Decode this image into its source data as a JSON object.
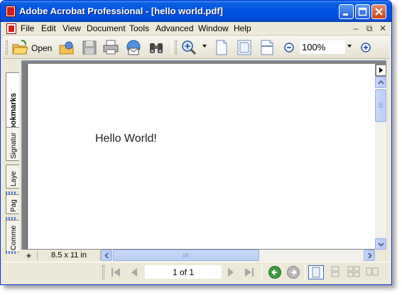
{
  "window": {
    "title": "Adobe Acrobat Professional - [hello world.pdf]"
  },
  "menu": {
    "items": [
      "File",
      "Edit",
      "View",
      "Document",
      "Tools",
      "Advanced",
      "Window",
      "Help"
    ]
  },
  "toolbar": {
    "open_label": "Open",
    "zoom_value": "100%"
  },
  "nav_tabs": [
    "Bookmarks",
    "Signatur",
    "Laye",
    "Pag",
    "Comme"
  ],
  "document": {
    "text": "Hello World!"
  },
  "statusbar": {
    "page_size": "8.5 x 11 in",
    "page_indicator": "1 of 1"
  },
  "colors": {
    "titlebar": "#0054e3",
    "chrome": "#ece9d8",
    "scrollbar": "#b9cdf4",
    "next_view_green": "#3c9a3c"
  },
  "icons": [
    "acrobat-logo-icon",
    "minimize-icon",
    "maximize-icon",
    "close-icon",
    "open-folder-icon",
    "organizer-icon",
    "save-icon",
    "print-icon",
    "email-icon",
    "search-binoculars-icon",
    "zoom-in-tool-icon",
    "actual-size-page-icon",
    "fit-page-icon",
    "fit-width-icon",
    "zoom-out-icon",
    "zoom-plus-icon",
    "first-page-icon",
    "previous-page-icon",
    "next-page-icon",
    "last-page-icon",
    "previous-view-icon",
    "next-view-icon",
    "single-page-layout-icon",
    "continuous-layout-icon",
    "facing-layout-icon",
    "continuous-facing-layout-icon"
  ]
}
